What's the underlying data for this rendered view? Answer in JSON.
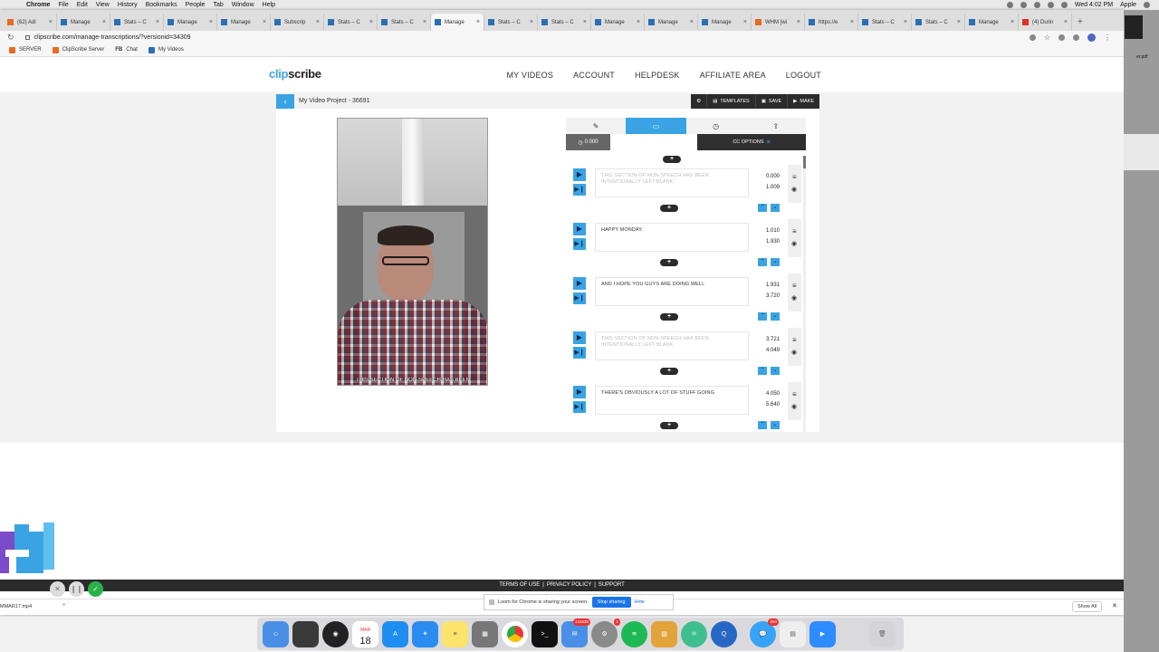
{
  "menubar": {
    "app": "Chrome",
    "items": [
      "File",
      "Edit",
      "View",
      "History",
      "Bookmarks",
      "People",
      "Tab",
      "Window",
      "Help"
    ],
    "clock": "Wed 4:02 PM",
    "user": "Apple"
  },
  "browser": {
    "tabs": [
      {
        "label": "(62) Adi",
        "fav": "orange"
      },
      {
        "label": "Manage",
        "fav": "blue"
      },
      {
        "label": "Stats – C",
        "fav": "blue"
      },
      {
        "label": "Manage",
        "fav": "blue"
      },
      {
        "label": "Manage",
        "fav": "blue"
      },
      {
        "label": "Subscrip",
        "fav": "blue"
      },
      {
        "label": "Stats – C",
        "fav": "blue"
      },
      {
        "label": "Stats – C",
        "fav": "blue"
      },
      {
        "label": "Manage",
        "fav": "blue",
        "active": true
      },
      {
        "label": "Stats – C",
        "fav": "blue"
      },
      {
        "label": "Stats – C",
        "fav": "blue"
      },
      {
        "label": "Manage",
        "fav": "blue"
      },
      {
        "label": "Manage",
        "fav": "blue"
      },
      {
        "label": "Manage",
        "fav": "blue"
      },
      {
        "label": "WHM [wi",
        "fav": "orange"
      },
      {
        "label": "https://e",
        "fav": "blue"
      },
      {
        "label": "Stats – C",
        "fav": "blue"
      },
      {
        "label": "Stats – C",
        "fav": "blue"
      },
      {
        "label": "Manage",
        "fav": "blue"
      },
      {
        "label": "(4) Durin",
        "fav": "red"
      }
    ],
    "url": "clipscribe.com/manage-transcriptions/?versionid=34309",
    "bookmarks": [
      {
        "label": "SERVER",
        "icon": "orange"
      },
      {
        "label": "ClipScribe Server",
        "icon": "orange"
      },
      {
        "label": "Chat",
        "icon": "fb",
        "prefix": "FB"
      },
      {
        "label": "My Videos",
        "icon": "blue"
      }
    ]
  },
  "site": {
    "logo_a": "clip",
    "logo_b": "scribe",
    "nav": [
      "MY VIDEOS",
      "ACCOUNT",
      "HELPDESK",
      "AFFILIATE AREA",
      "LOGOUT"
    ],
    "project_title": "My Video Project - 36691",
    "actions": {
      "templates": "TEMPLATES",
      "save": "SAVE",
      "make": "MAKE"
    },
    "video_caption": "THIS SECTION OF NON-SPEECH HAS BEEN",
    "panel": {
      "time": "0.000",
      "cc_options": "CC OPTIONS"
    },
    "segments": [
      {
        "text": "THIS SECTION OF NON-SPEECH HAS BEEN INTENTIONALLY LEFT BLANK.",
        "start": "0.000",
        "end": "1.009",
        "muted": true
      },
      {
        "text": "HAPPY MONDAY.",
        "start": "1.010",
        "end": "1.930",
        "muted": false
      },
      {
        "text": "AND I HOPE YOU GUYS ARE DOING WELL",
        "start": "1.931",
        "end": "3.720",
        "muted": false
      },
      {
        "text": "THIS SECTION OF NON-SPEECH HAS BEEN INTENTIONALLY LEFT BLANK.",
        "start": "3.721",
        "end": "4.049",
        "muted": true
      },
      {
        "text": "THERE'S OBVIOUSLY A LOT OF STUFF GOING",
        "start": "4.050",
        "end": "5.640",
        "muted": false
      }
    ],
    "footer": [
      "TERMS OF USE",
      "PRIVACY POLICY",
      "SUPPORT"
    ]
  },
  "loom": {
    "message": "Loom for Chrome is sharing your screen.",
    "stop": "Stop sharing",
    "hide": "Hide"
  },
  "downloads": {
    "file": "MMAR17.mp4",
    "show_all": "Show All"
  },
  "bg_window": {
    "label": "er.pdf"
  },
  "dock": {
    "calendar_month": "MAR",
    "calendar_day": "18",
    "badges": {
      "mail": "131536",
      "prefs": "1",
      "messages": "250"
    }
  },
  "colors": {
    "accent": "#3aa3e3",
    "dark": "#2b2b2b",
    "loom_green": "#2ab24a"
  }
}
